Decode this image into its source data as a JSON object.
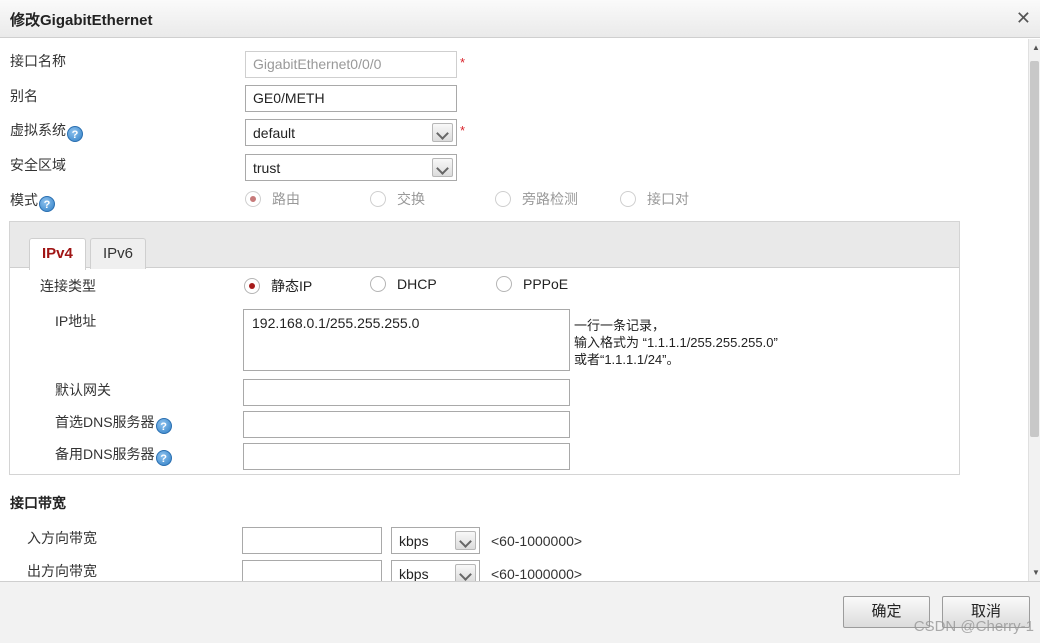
{
  "dialog": {
    "title": "修改GigabitEthernet"
  },
  "form": {
    "interface_name_label": "接口名称",
    "interface_name_value": "GigabitEthernet0/0/0",
    "alias_label": "别名",
    "alias_value": "GE0/METH",
    "vsys_label": "虚拟系统",
    "vsys_value": "default",
    "zone_label": "安全区域",
    "zone_value": "trust",
    "mode_label": "模式",
    "mode_options": [
      "路由",
      "交换",
      "旁路检测",
      "接口对"
    ],
    "mode_selected": "路由",
    "required_mark": "*",
    "help_glyph": "?"
  },
  "ipv_tabs": {
    "tabs": [
      "IPv4",
      "IPv6"
    ],
    "active": "IPv4",
    "conn_type_label": "连接类型",
    "conn_type_options": [
      "静态IP",
      "DHCP",
      "PPPoE"
    ],
    "conn_type_selected": "静态IP",
    "ip_label": "IP地址",
    "ip_value": "192.168.0.1/255.255.255.0",
    "ip_hint": [
      "一行一条记录，",
      "输入格式为 “1.1.1.1/255.255.255.0”",
      "或者“1.1.1.1/24”。"
    ],
    "gateway_label": "默认网关",
    "gateway_value": "",
    "dns1_label": "首选DNS服务器",
    "dns1_value": "",
    "dns2_label": "备用DNS服务器",
    "dns2_value": ""
  },
  "bandwidth": {
    "section_title": "接口带宽",
    "in_label": "入方向带宽",
    "in_value": "",
    "in_unit": "kbps",
    "in_range": "<60-1000000>",
    "out_label": "出方向带宽",
    "out_value": "",
    "out_unit": "kbps",
    "out_range": "<60-1000000>"
  },
  "footer": {
    "ok_label": "确定",
    "cancel_label": "取消"
  },
  "watermark": "CSDN @Cherry-1",
  "icons": {
    "close": "close-icon",
    "help": "help-icon",
    "dropdown": "chevron-down-icon"
  },
  "colors": {
    "accent": "#a01515",
    "required": "#d9222a",
    "help": "#2f7fc6"
  }
}
